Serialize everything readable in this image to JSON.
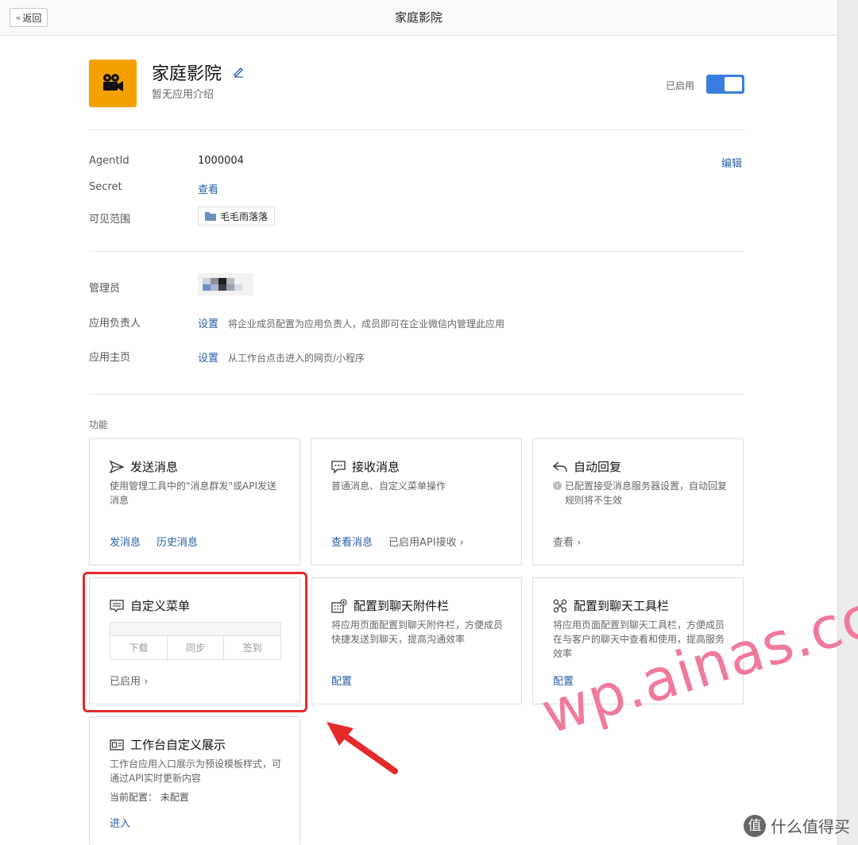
{
  "topbar": {
    "back_label": "返回",
    "title": "家庭影院"
  },
  "app": {
    "name": "家庭影院",
    "description": "暂无应用介绍",
    "enabled_label": "已启用",
    "enabled": true,
    "icon": "film-camera-icon",
    "icon_color": "#f4a100"
  },
  "details": {
    "agentid_label": "AgentId",
    "agentid_value": "1000004",
    "edit_label": "编辑",
    "secret_label": "Secret",
    "secret_link": "查看",
    "scope_label": "可见范围",
    "scope_value": "毛毛雨落落"
  },
  "admin": {
    "admin_label": "管理员",
    "owner_label": "应用负责人",
    "owner_link": "设置",
    "owner_hint": "将企业成员配置为应用负责人，成员即可在企业微信内管理此应用",
    "home_label": "应用主页",
    "home_link": "设置",
    "home_hint": "从工作台点击进入的网页/小程序"
  },
  "features": {
    "section_label": "功能",
    "cards": [
      {
        "title": "发送消息",
        "icon": "send-icon",
        "desc": "使用管理工具中的\"消息群发\"或API发送消息",
        "links": [
          "发消息",
          "历史消息"
        ]
      },
      {
        "title": "接收消息",
        "icon": "chat-bubble-icon",
        "desc": "普通消息、自定义菜单操作",
        "links": [
          "查看消息",
          "已启用API接收 ›"
        ]
      },
      {
        "title": "自动回复",
        "icon": "reply-icon",
        "desc": "已配置接受消息服务器设置，自动回复规则将不生效",
        "links": [
          "查看 ›"
        ]
      },
      {
        "title": "自定义菜单",
        "icon": "menu-icon",
        "menu_items": [
          "下载",
          "同步",
          "签到"
        ],
        "links": [
          "已启用 ›"
        ]
      },
      {
        "title": "配置到聊天附件栏",
        "icon": "attachment-bar-icon",
        "desc": "将应用页面配置到聊天附件栏，方便成员快捷发送到聊天，提高沟通效率",
        "links": [
          "配置"
        ]
      },
      {
        "title": "配置到聊天工具栏",
        "icon": "toolbar-icon",
        "desc": "将应用页面配置到聊天工具栏，方便成员在与客户的聊天中查看和使用，提高服务效率",
        "links": [
          "配置"
        ]
      },
      {
        "title": "工作台自定义展示",
        "icon": "workbench-icon",
        "desc": "工作台应用入口展示为预设模板样式，可通过API实时更新内容",
        "current_config": "当前配置： 未配置",
        "links": [
          "进入"
        ]
      }
    ]
  },
  "overlay": {
    "highlight_color": "#e62a2a",
    "watermark": "wp.ainas.cc",
    "site_mark": "什么值得买",
    "site_mark_badge": "值"
  }
}
